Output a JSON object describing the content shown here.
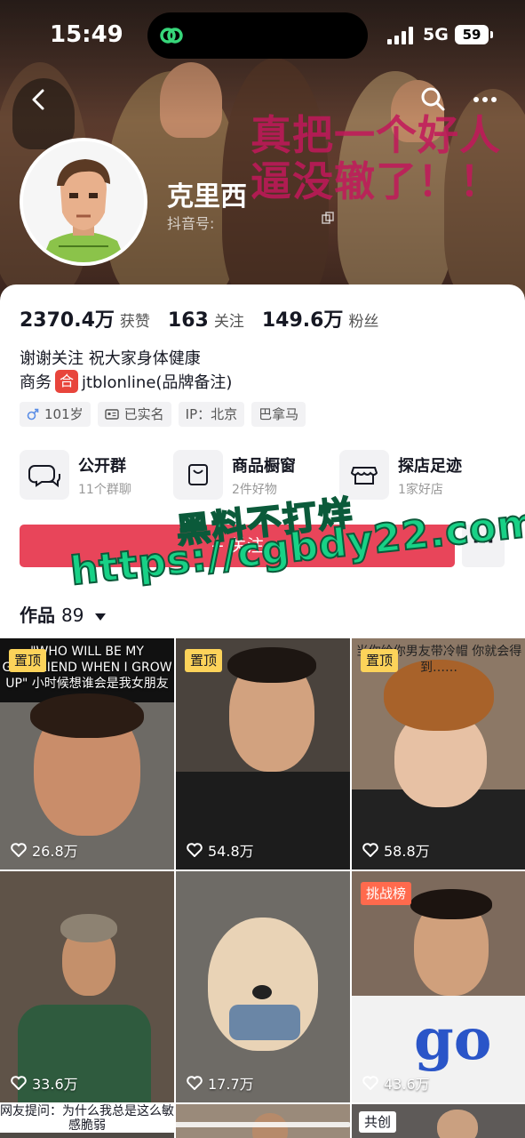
{
  "status_bar": {
    "time": "15:49",
    "network": "5G",
    "battery": "59"
  },
  "header": {
    "overlay_line1": "真把一个好人",
    "overlay_line2": "逼没辙了！！",
    "name": "克里西",
    "douyin_id_label": "抖音号:"
  },
  "stats": [
    {
      "num": "2370.4万",
      "label": "获赞"
    },
    {
      "num": "163",
      "label": "关注"
    },
    {
      "num": "149.6万",
      "label": "粉丝"
    }
  ],
  "bio": {
    "line1": "谢谢关注 祝大家身体健康",
    "line2_prefix": "商务",
    "badge": "合",
    "line2_suffix": "jtblonline(品牌备注)"
  },
  "tags": [
    {
      "text": "101岁",
      "icon": "male-icon"
    },
    {
      "text": "已实名",
      "icon": "id-card-icon"
    },
    {
      "text": "IP：北京",
      "icon": ""
    },
    {
      "text": "巴拿马",
      "icon": ""
    }
  ],
  "entries": [
    {
      "title": "公开群",
      "sub": "11个群聊",
      "icon": "chat-bubbles-icon"
    },
    {
      "title": "商品橱窗",
      "sub": "2件好物",
      "icon": "shopping-bag-icon"
    },
    {
      "title": "探店足迹",
      "sub": "1家好店",
      "icon": "store-icon"
    }
  ],
  "follow_button": "+ 关注",
  "follow_more": "···",
  "watermark": {
    "line1": "黑料不打烊",
    "line2": "https://cgbdy22.com"
  },
  "works": {
    "label": "作品",
    "count": "89"
  },
  "videos": [
    {
      "badge": "置顶",
      "badge_type": "pin",
      "caption": "\"WHO WILL BE MY GIRLFRIEND WHEN I GROW UP\" 小时候想谁会是我女朋友",
      "likes": "26.8万"
    },
    {
      "badge": "置顶",
      "badge_type": "pin",
      "caption": "",
      "likes": "54.8万"
    },
    {
      "badge": "置顶",
      "badge_type": "pin",
      "caption": "当你给你男友带冷帽 你就会得到……",
      "likes": "58.8万"
    },
    {
      "badge": "",
      "badge_type": "",
      "caption": "",
      "likes": "33.6万"
    },
    {
      "badge": "",
      "badge_type": "",
      "caption": "",
      "likes": "17.7万"
    },
    {
      "badge": "挑战榜",
      "badge_type": "challenge",
      "caption": "",
      "likes": "43.6万"
    }
  ],
  "bottom_row": [
    {
      "caption": "网友提问：为什么我总是这么敏感脆弱"
    },
    {
      "caption": ""
    },
    {
      "caption": "共创"
    }
  ],
  "colors": {
    "accent": "#e8455a",
    "pin": "#fcd35a",
    "challenge": "#ff6a4d",
    "watermark": "#18d186",
    "overlay": "#c2185b"
  }
}
